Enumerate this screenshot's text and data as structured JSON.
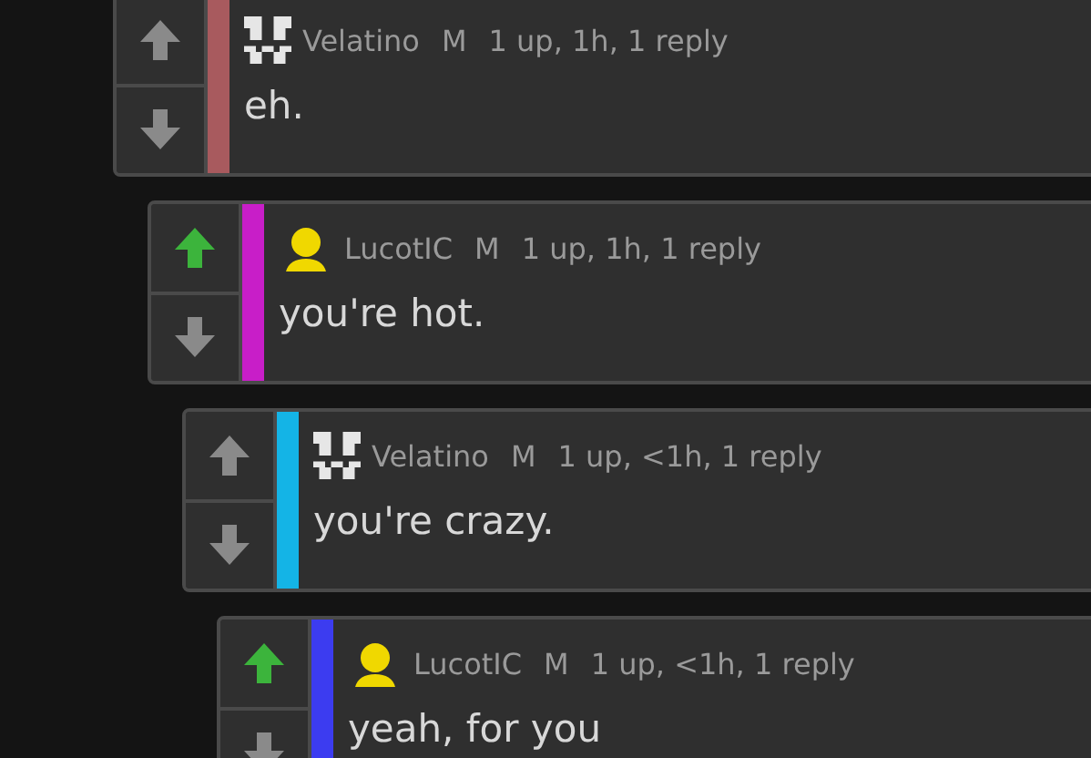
{
  "comments": [
    {
      "author": "Velatino",
      "gender": "M",
      "meta": "1 up, 1h, 1 reply",
      "body": "eh.",
      "kind": "pattern",
      "color": "#a85a5e",
      "upvoted": false,
      "children": [
        {
          "author": "LucotIC",
          "gender": "M",
          "meta": "1 up, 1h, 1 reply",
          "body": "you're hot.",
          "kind": "person",
          "color": "#c81ec8",
          "upvoted": true,
          "children": [
            {
              "author": "Velatino",
              "gender": "M",
              "meta": "1 up, <1h, 1 reply",
              "body": "you're crazy.",
              "kind": "pattern",
              "color": "#14b4e6",
              "upvoted": false,
              "children": [
                {
                  "author": "LucotIC",
                  "gender": "M",
                  "meta": "1 up, <1h, 1 reply",
                  "body": "yeah, for you",
                  "kind": "person",
                  "color": "#3c3cf0",
                  "upvoted": true
                }
              ]
            }
          ]
        }
      ]
    }
  ]
}
